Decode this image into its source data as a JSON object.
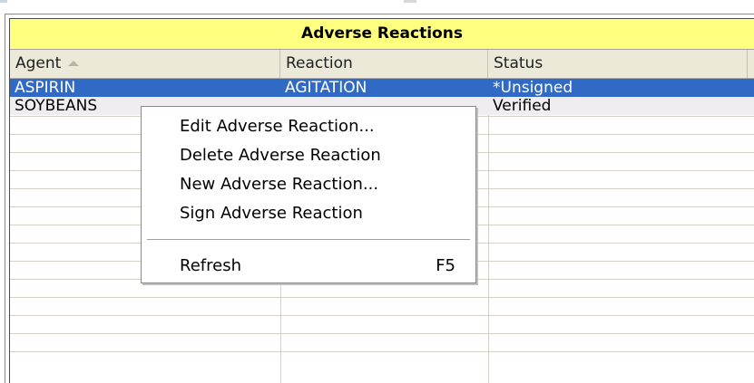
{
  "panel": {
    "title": "Adverse Reactions"
  },
  "table": {
    "columns": [
      {
        "label": "Agent",
        "sorted": "ascending"
      },
      {
        "label": "Reaction"
      },
      {
        "label": "Status"
      }
    ],
    "rows": [
      {
        "agent": "ASPIRIN",
        "reaction": "AGITATION",
        "status": "*Unsigned",
        "selected": true
      },
      {
        "agent": "SOYBEANS",
        "reaction": "",
        "status": "Verified",
        "selected": false
      }
    ]
  },
  "context_menu": {
    "items": [
      {
        "label": "Edit Adverse Reaction...",
        "shortcut": ""
      },
      {
        "label": "Delete Adverse Reaction",
        "shortcut": ""
      },
      {
        "label": "New Adverse Reaction...",
        "shortcut": ""
      },
      {
        "label": "Sign Adverse Reaction",
        "shortcut": ""
      },
      {
        "label": "Refresh",
        "shortcut": "F5"
      }
    ]
  },
  "colors": {
    "title_bg": "#ffff80",
    "selection": "#316ac5",
    "alt_row": "#f0ecef",
    "header_bg": "#ece9d8"
  }
}
